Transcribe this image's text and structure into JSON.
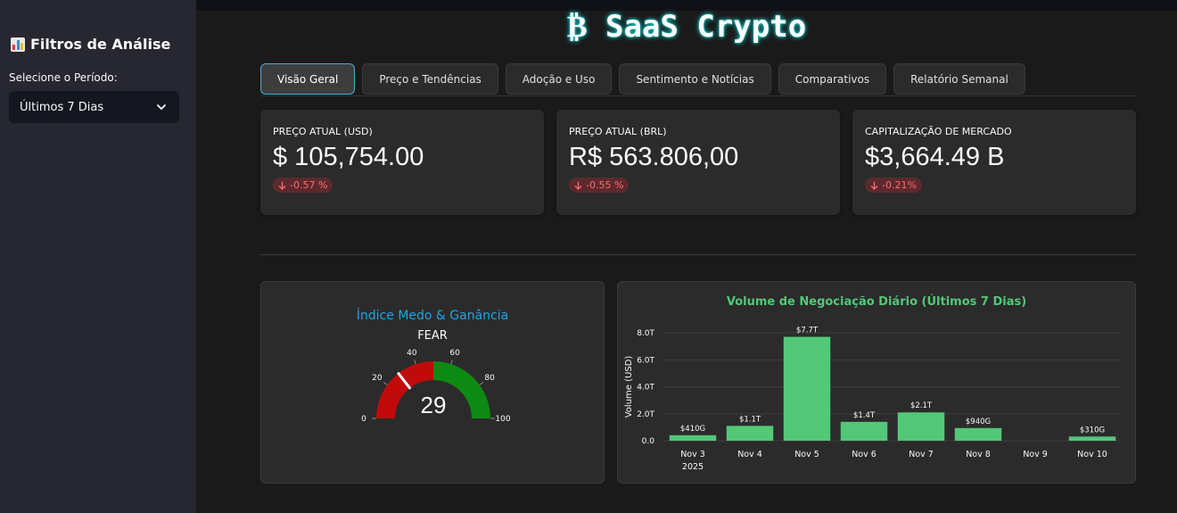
{
  "sidebar": {
    "title": "Filtros de Análise",
    "period_label": "Selecione o Período:",
    "period_value": "Últimos 7 Dias"
  },
  "app": {
    "title": "SaaS Crypto",
    "title_glyph": "₿"
  },
  "tabs": [
    {
      "label": "Visão Geral",
      "active": true
    },
    {
      "label": "Preço e Tendências"
    },
    {
      "label": "Adoção e Uso"
    },
    {
      "label": "Sentimento e Notícias"
    },
    {
      "label": "Comparativos"
    },
    {
      "label": "Relatório Semanal"
    }
  ],
  "metrics": [
    {
      "label": "PREÇO ATUAL (USD)",
      "value": "$ 105,754.00",
      "delta": "-0.57 %"
    },
    {
      "label": "PREÇO ATUAL (BRL)",
      "value": "R$ 563.806,00",
      "delta": "-0.55 %"
    },
    {
      "label": "CAPITALIZAÇÃO DE MERCADO",
      "value": "$3,664.49 B",
      "delta": "-0.21%"
    }
  ],
  "colors": {
    "accent": "#1fa3e8",
    "positive": "#52c878",
    "negative": "#ff6b6b",
    "gauge_red": "#c10b0b",
    "gauge_green": "#0d8a13"
  },
  "chart_data": [
    {
      "type": "gauge",
      "title": "Índice Medo & Ganância",
      "subtitle": "FEAR",
      "value": 29,
      "range": [
        0,
        100
      ],
      "ticks": [
        0,
        20,
        40,
        60,
        80,
        100
      ],
      "bands": [
        {
          "from": 0,
          "to": 50,
          "color": "#c10b0b"
        },
        {
          "from": 50,
          "to": 100,
          "color": "#0d8a13"
        }
      ]
    },
    {
      "type": "bar",
      "title": "Volume de Negociação Diário (Últimos 7 Dias)",
      "ylabel": "Volume (USD)",
      "categories": [
        "Nov 3",
        "Nov 4",
        "Nov 5",
        "Nov 6",
        "Nov 7",
        "Nov 8",
        "Nov 9",
        "Nov 10"
      ],
      "x_sublabel": "2025",
      "values": [
        410,
        1100,
        7700,
        1400,
        2100,
        940,
        0,
        310
      ],
      "value_unit": "billions USD",
      "data_labels": [
        "$410G",
        "$1.1T",
        "$7.7T",
        "$1.4T",
        "$2.1T",
        "$940G",
        "",
        "$310G"
      ],
      "ylim": [
        0,
        8000
      ],
      "yticks": [
        0,
        2000,
        4000,
        6000,
        8000
      ],
      "ytick_labels": [
        "0.0",
        "2.0T",
        "4.0T",
        "6.0T",
        "8.0T"
      ],
      "bar_color": "#52c878",
      "grid": true
    }
  ]
}
